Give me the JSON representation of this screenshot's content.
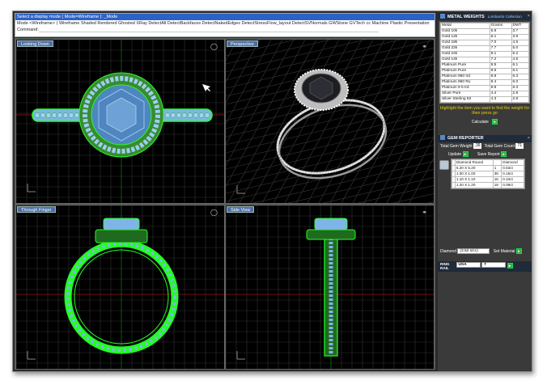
{
  "command_area": {
    "line1": "Select a display mode ( Mode=Wireframe ): _Mode",
    "line2": "Mode <Wireframe> ( Wireframe  Shaded  Rendered  Ghosted  XRay  DetectAll  DetectBackfaces  DetectNakedEdges  DetectStressFlow_layout  DetectSVNormals  GWStone  GVTech  cc  Machine  Plastic  Presentation",
    "prompt_label": "Command:"
  },
  "viewports": [
    {
      "title": "Looking Down"
    },
    {
      "title": "Perspective"
    },
    {
      "title": "Through Finger"
    },
    {
      "title": "Side View"
    }
  ],
  "metal_weights": {
    "header": "METAL WEIGHTS",
    "header_link": "Lombardo Collection",
    "columns": [
      "Metal",
      "Grams",
      "DWT"
    ],
    "rows": [
      [
        "Gold 10k",
        "5.8",
        "3.7"
      ],
      [
        "Gold 14k",
        "6.1",
        "3.9"
      ],
      [
        "Gold 18k",
        "7.0",
        "4.5"
      ],
      [
        "Gold 22k",
        "7.7",
        "5.0"
      ],
      [
        "Gold 24k",
        "8.1",
        "5.2"
      ],
      [
        "Gold 14k",
        "7.2",
        "4.6"
      ],
      [
        "Platinum Pure",
        "9.5",
        "6.1"
      ],
      [
        "Platinum Pure",
        "9.5",
        "6.1"
      ],
      [
        "Platinum 950 Ird",
        "9.8",
        "6.3"
      ],
      [
        "Platinum 950 Ru",
        "9.4",
        "6.0"
      ],
      [
        "Platinum 9 5 Ird",
        "9.8",
        "6.3"
      ],
      [
        "Silver Pure",
        "4.4",
        "2.8"
      ],
      [
        "Silver Sterling 92",
        "4.3",
        "2.8"
      ]
    ],
    "instruction": "Highlight the item you want to find the weight for then press go",
    "calculate_label": "Calculate",
    "go_label": "▸"
  },
  "gem_reporter": {
    "header": "GEM REPORTER",
    "total_weight_label": "Total Gem Weight",
    "total_weight_value": ".39",
    "total_count_label": "Total Gem Count",
    "total_count_value": "71",
    "update_label": "Update",
    "save_label": "Save Report",
    "table_headers": [
      "",
      "Diamond Round",
      "",
      "Diamond"
    ],
    "rows": [
      [
        "5.20 X 5.20",
        "1",
        "0.53ct"
      ],
      [
        "1.00 X 1.00",
        "36",
        "0.16ct"
      ],
      [
        "1.10 X 1.10",
        "16",
        "0.10ct"
      ],
      [
        "1.20 X 1.20",
        "18",
        "0.09ct"
      ]
    ],
    "material_label": "Diamond",
    "material_value": "(3.52 s/cc)",
    "set_material_label": "Set Material"
  },
  "ring_rail": {
    "header": "RING RAIL",
    "region": "USA",
    "size": "7"
  },
  "colors": {
    "frame": "#2b2b2b",
    "viewport_bg": "#000000",
    "grid": "#3a3a3a",
    "grid_red": "#7a1010",
    "grid_green": "#0e5a0e",
    "wire_green": "#22ff22",
    "gem_blue": "#7fb4e8",
    "title_bg": "#4b6ea8",
    "accent_yellow": "#e8d000",
    "button_green": "#3faa3f"
  },
  "icons": [
    "ring-front-icon",
    "ring-angle-icon",
    "ring-side-icon",
    "gem-thumbnail-icon",
    "close-icon",
    "go-arrow-icon",
    "dropdown-arrow-icon",
    "axis-icon",
    "cursor-icon"
  ]
}
